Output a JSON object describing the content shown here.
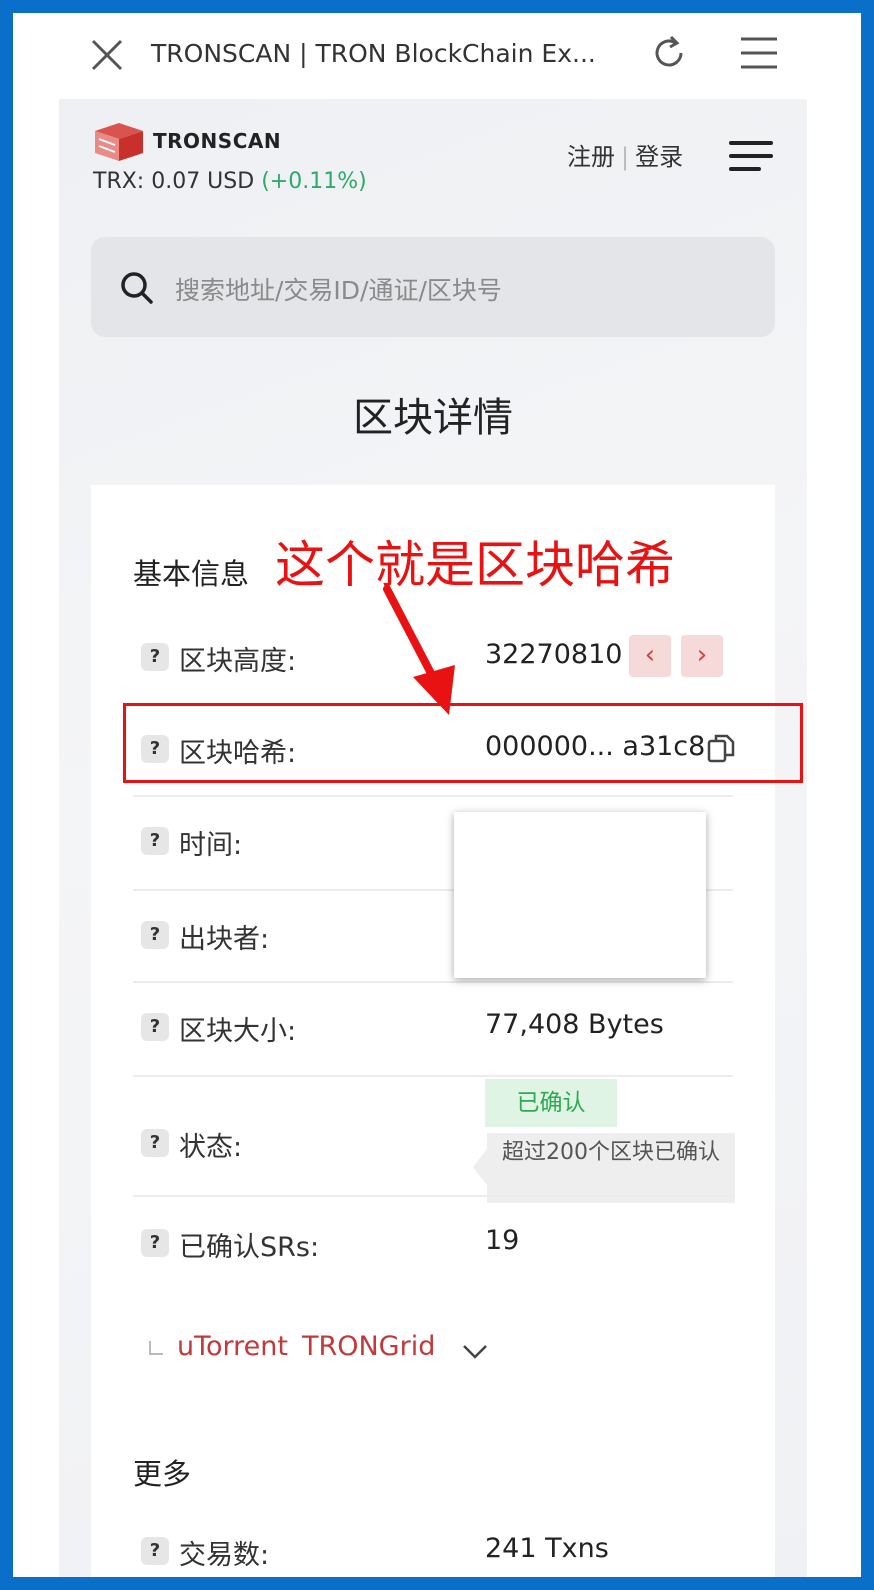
{
  "browser": {
    "title": "TRONSCAN | TRON BlockChain Ex..."
  },
  "header": {
    "brand": "TRONSCAN",
    "price_text": "TRX: 0.07 USD",
    "price_change": "(+0.11%)",
    "register": "注册",
    "login": "登录"
  },
  "search": {
    "placeholder": "搜索地址/交易ID/通证/区块号"
  },
  "page_title": "区块详情",
  "basic_info": {
    "title": "基本信息",
    "annotation": "这个就是区块哈希",
    "rows": {
      "height": {
        "label": "区块高度:",
        "value": "32270810"
      },
      "hash": {
        "label": "区块哈希:",
        "value": "000000... a31c8"
      },
      "time": {
        "label": "时间:"
      },
      "producer": {
        "label": "出块者:"
      },
      "size": {
        "label": "区块大小:",
        "value": "77,408 Bytes"
      },
      "status": {
        "label": "状态:",
        "badge": "已确认",
        "tooltip": "超过200个区块已确认"
      },
      "confirmed_srs": {
        "label": "已确认SRs:",
        "value": "19"
      }
    },
    "srs": [
      "uTorrent",
      "TRONGrid"
    ]
  },
  "more": {
    "title": "更多",
    "tx_label": "交易数:",
    "tx_value": "241 Txns"
  },
  "colors": {
    "frame": "#0a6fc9",
    "annotation": "#e81212",
    "positive": "#2eaa6a",
    "sr_link": "#c0393b"
  },
  "icons": [
    "close-icon",
    "refresh-icon",
    "menu-icon",
    "tronscan-logo",
    "hamburger-icon",
    "search-icon",
    "chevron-left-icon",
    "chevron-right-icon",
    "copy-icon",
    "chevron-down-icon"
  ]
}
